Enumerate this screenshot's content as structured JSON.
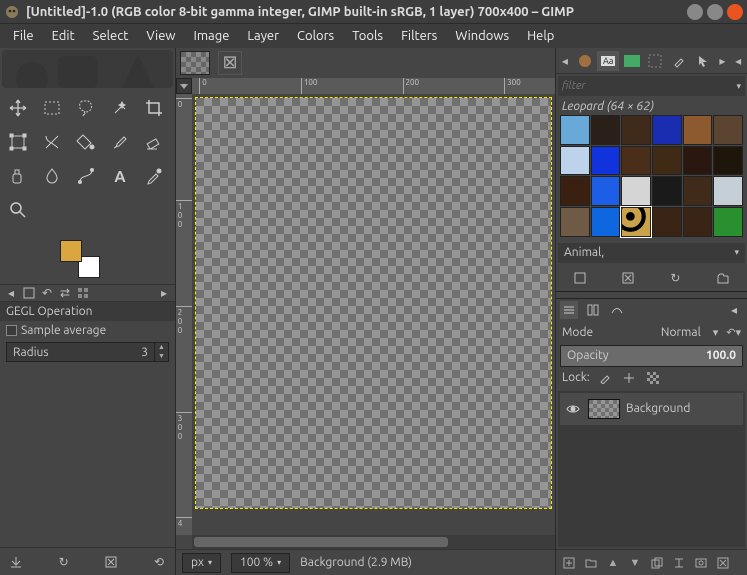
{
  "window": {
    "title": "[Untitled]-1.0 (RGB color 8-bit gamma integer, GIMP built-in sRGB, 1 layer) 700x400 – GIMP"
  },
  "menubar": [
    "File",
    "Edit",
    "Select",
    "View",
    "Image",
    "Layer",
    "Colors",
    "Tools",
    "Filters",
    "Windows",
    "Help"
  ],
  "toolbox": {
    "fg_color": "#d9a640",
    "bg_color": "#ffffff"
  },
  "tool_options": {
    "title": "GEGL Operation",
    "sample_average_label": "Sample average",
    "radius_label": "Radius",
    "radius_value": "3"
  },
  "canvas": {
    "ruler_h": [
      "0",
      "100",
      "200",
      "300"
    ],
    "ruler_v": [
      "0",
      "1",
      "2",
      "3",
      "4"
    ],
    "ruler_v_sub": [
      "0",
      "0",
      "0",
      "0"
    ]
  },
  "statusbar": {
    "unit": "px",
    "zoom": "100 %",
    "label": "Background (2.9 MB)"
  },
  "patterns": {
    "filter_placeholder": "filter",
    "selected_title": "Leopard (64 × 62)",
    "tag": "Animal,",
    "swatches": [
      "#69a9d9",
      "#2a1f19",
      "#402a1a",
      "#1a2db0",
      "#8c5a2e",
      "#5c4530",
      "#bcd3eb",
      "#1133dd",
      "#4a2e1a",
      "#3e2a15",
      "#2a1810",
      "#1e150b",
      "#3a2011",
      "#1c5fe6",
      "#d5d5d5",
      "#1a1a1a",
      "#402a1a",
      "#c7cfd6",
      "#6e5a45",
      "#0f67e0",
      "#c9a24a",
      "#3a2416",
      "#3a2416",
      "#2a8f2f"
    ]
  },
  "layers_panel": {
    "mode_label": "Mode",
    "mode_value": "Normal",
    "opacity_label": "Opacity",
    "opacity_value": "100.0",
    "lock_label": "Lock:",
    "items": [
      {
        "name": "Background",
        "visible": true
      }
    ]
  }
}
